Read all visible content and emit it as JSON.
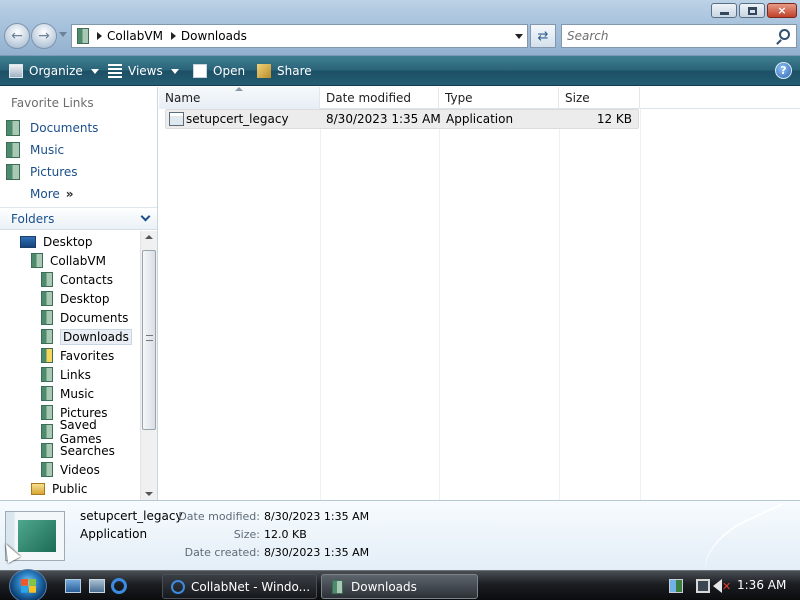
{
  "window": {
    "controls": {
      "minimize": "minimize",
      "maximize": "maximize",
      "close": "×"
    }
  },
  "address": {
    "crumbs": [
      "CollabVM",
      "Downloads"
    ]
  },
  "search": {
    "placeholder": "Search"
  },
  "toolbar": {
    "organize": "Organize",
    "views": "Views",
    "open": "Open",
    "share": "Share",
    "help": "?"
  },
  "nav": {
    "favorites_heading": "Favorite Links",
    "favorites": [
      "Documents",
      "Music",
      "Pictures"
    ],
    "more": "More",
    "more_arrow": "»",
    "folders_heading": "Folders",
    "tree": [
      {
        "label": "Desktop",
        "level": 0
      },
      {
        "label": "CollabVM",
        "level": 1
      },
      {
        "label": "Contacts",
        "level": 2
      },
      {
        "label": "Desktop",
        "level": 2
      },
      {
        "label": "Documents",
        "level": 2
      },
      {
        "label": "Downloads",
        "level": 2,
        "selected": true
      },
      {
        "label": "Favorites",
        "level": 2
      },
      {
        "label": "Links",
        "level": 2
      },
      {
        "label": "Music",
        "level": 2
      },
      {
        "label": "Pictures",
        "level": 2
      },
      {
        "label": "Saved Games",
        "level": 2
      },
      {
        "label": "Searches",
        "level": 2
      },
      {
        "label": "Videos",
        "level": 2
      },
      {
        "label": "Public",
        "level": 1
      }
    ]
  },
  "filelist": {
    "columns": [
      "Name",
      "Date modified",
      "Type",
      "Size"
    ],
    "rows": [
      {
        "name": "setupcert_legacy",
        "date": "8/30/2023 1:35 AM",
        "type": "Application",
        "size": "12 KB"
      }
    ]
  },
  "details": {
    "name": "setupcert_legacy",
    "type": "Application",
    "modified_label": "Date modified:",
    "modified": "8/30/2023 1:35 AM",
    "size_label": "Size:",
    "size": "12.0 KB",
    "created_label": "Date created:",
    "created": "8/30/2023 1:35 AM"
  },
  "taskbar": {
    "tasks": [
      "CollabNet - Windo...",
      "Downloads"
    ],
    "clock": "1:36 AM"
  }
}
